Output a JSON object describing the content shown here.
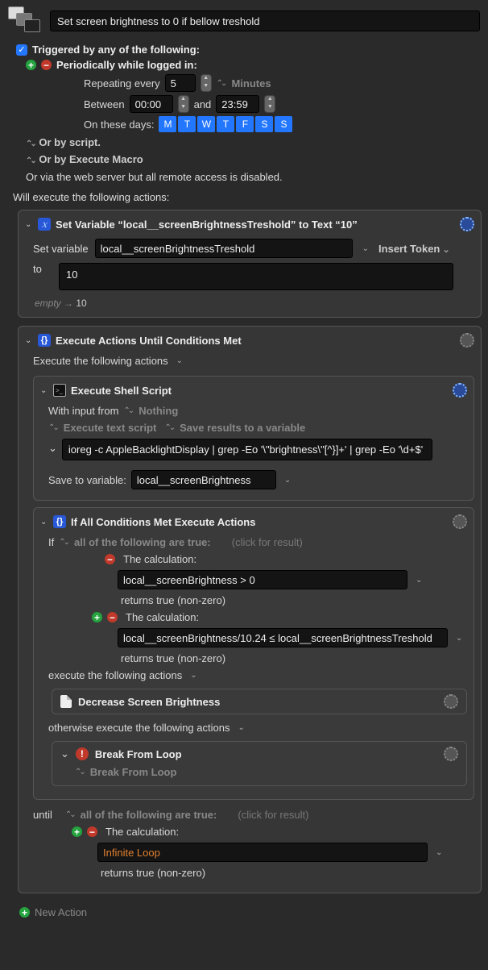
{
  "header": {
    "title": "Set screen brightness to 0 if bellow treshold"
  },
  "triggers": {
    "heading": "Triggered by any of the following:",
    "periodic_label": "Periodically while logged in:",
    "repeat_label": "Repeating every",
    "repeat_value": "5",
    "repeat_unit": "Minutes",
    "between_label": "Between",
    "time_start": "00:00",
    "and_label": "and",
    "time_end": "23:59",
    "days_label": "On these days:",
    "days": [
      "M",
      "T",
      "W",
      "T",
      "F",
      "S",
      "S"
    ],
    "or_script": "Or by script.",
    "or_macro": "Or by Execute Macro",
    "or_web": "Or via the web server but all remote access is disabled."
  },
  "exec_heading": "Will execute the following actions:",
  "action_setvar": {
    "title": "Set Variable “local__screenBrightnessTreshold” to Text “10”",
    "set_var_label": "Set variable",
    "var_name": "local__screenBrightnessTreshold",
    "insert_token": "Insert Token",
    "to_label": "to",
    "to_value": "10",
    "result_prefix": "empty",
    "result_arrow": "→",
    "result_value": "10"
  },
  "action_loop": {
    "title": "Execute Actions Until Conditions Met",
    "exec_label": "Execute the following actions",
    "shell": {
      "title": "Execute Shell Script",
      "with_input_label": "With input from",
      "with_input_value": "Nothing",
      "mode1": "Execute text script",
      "mode2": "Save results to a variable",
      "script": "ioreg -c AppleBacklightDisplay | grep -Eo '\\\"brightness\\\"[^}]+' | grep -Eo '\\d+$'",
      "save_label": "Save to variable:",
      "save_var": "local__screenBrightness"
    },
    "if": {
      "title": "If All Conditions Met Execute Actions",
      "if_label": "If",
      "if_cond": "all of the following are true:",
      "click": "(click for result)",
      "calc_label": "The calculation:",
      "calc1": "local__screenBrightness > 0",
      "calc2": "local__screenBrightness/10.24 ≤ local__screenBrightnessTreshold",
      "returns": "returns true (non-zero)",
      "exec_then": "execute the following actions",
      "decrease": "Decrease Screen Brightness",
      "exec_else": "otherwise execute the following actions",
      "break_title": "Break From Loop",
      "break_sub": "Break From Loop"
    },
    "until_label": "until",
    "until_cond": "all of the following are true:",
    "until_click": "(click for result)",
    "calc_label2": "The calculation:",
    "calc3": "Infinite Loop",
    "returns2": "returns true (non-zero)"
  },
  "footer": {
    "new_action": "New Action"
  }
}
